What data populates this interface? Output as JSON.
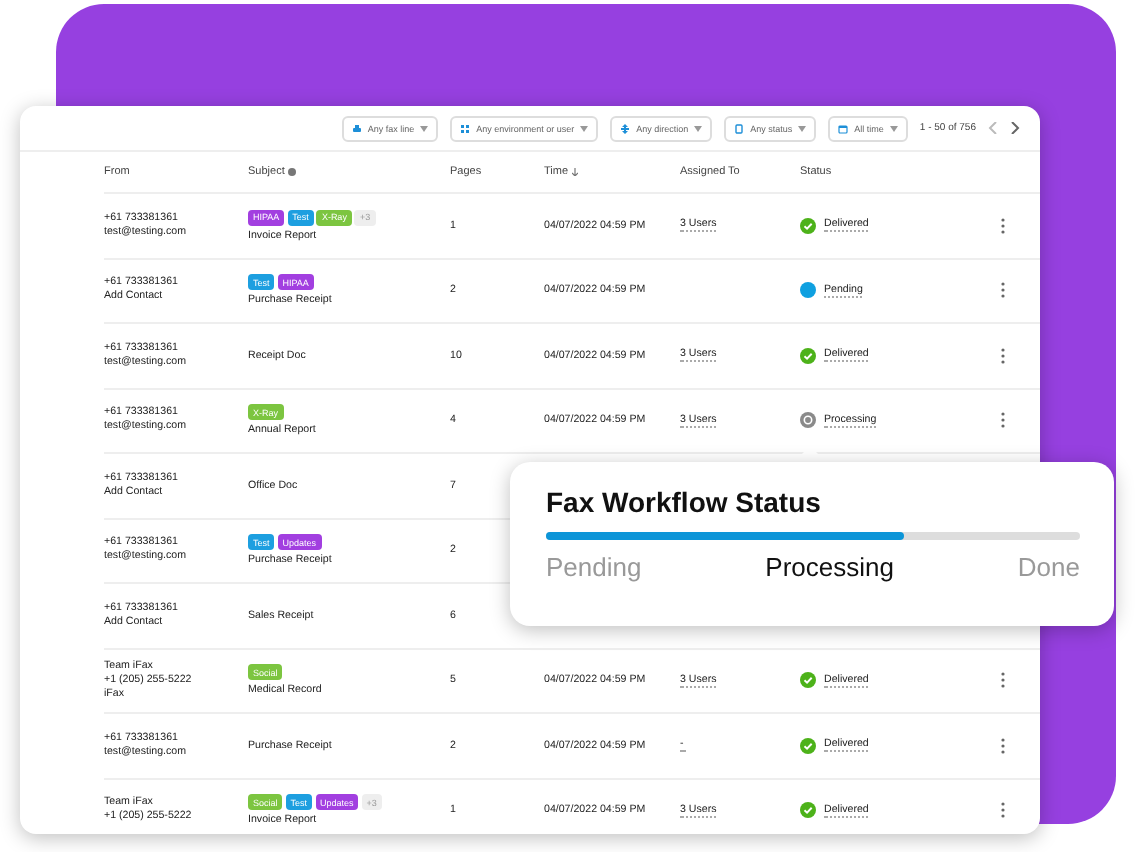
{
  "filters": [
    {
      "kind": "line",
      "label": "Any fax line"
    },
    {
      "kind": "env",
      "label": "Any environment or user"
    },
    {
      "kind": "direction",
      "label": "Any direction"
    },
    {
      "kind": "status",
      "label": "Any status"
    },
    {
      "kind": "time",
      "label": "All time"
    }
  ],
  "pagination": {
    "range": "1 - 50 of 756"
  },
  "table": {
    "columns": [
      "From",
      "Subject",
      "Pages",
      "Time",
      "Assigned To",
      "Status"
    ],
    "rows": [
      {
        "from": [
          "+61 733381361",
          "test@testing.com"
        ],
        "tags": [
          {
            "label": "HIPAA",
            "color": "#a23fe0"
          },
          {
            "label": "Test",
            "color": "#1d9fe0"
          },
          {
            "label": "X-Ray",
            "color": "#7cc540"
          },
          {
            "label": "+3",
            "color": "#eeeeee"
          }
        ],
        "subject": "Invoice Report",
        "pages": "1",
        "time": "04/07/2022 04:59 PM",
        "assigned": "3 Users",
        "status": {
          "kind": "delivered",
          "label": "Delivered"
        }
      },
      {
        "from": [
          "+61 733381361",
          "Add Contact"
        ],
        "tags": [
          {
            "label": "Test",
            "color": "#1d9fe0"
          },
          {
            "label": "HIPAA",
            "color": "#a23fe0"
          }
        ],
        "subject": "Purchase Receipt",
        "pages": "2",
        "time": "04/07/2022 04:59 PM",
        "status": {
          "kind": "pending",
          "label": "Pending"
        }
      },
      {
        "from": [
          "+61 733381361",
          "test@testing.com"
        ],
        "subject": "Receipt Doc",
        "pages": "10",
        "time": "04/07/2022 04:59 PM",
        "assigned": "3 Users",
        "status": {
          "kind": "delivered",
          "label": "Delivered"
        }
      },
      {
        "from": [
          "+61 733381361",
          "test@testing.com"
        ],
        "tags": [
          {
            "label": "X-Ray",
            "color": "#7cc540"
          }
        ],
        "subject": "Annual Report",
        "pages": "4",
        "time": "04/07/2022 04:59 PM",
        "assigned": "3 Users",
        "status": {
          "kind": "processing",
          "label": "Processing"
        }
      },
      {
        "from": [
          "+61 733381361",
          "Add Contact"
        ],
        "subject": "Office Doc",
        "pages": "7"
      },
      {
        "from": [
          "+61 733381361",
          "test@testing.com"
        ],
        "tags": [
          {
            "label": "Test",
            "color": "#1d9fe0"
          },
          {
            "label": "Updates",
            "color": "#a23fe0"
          }
        ],
        "subject": "Purchase Receipt",
        "pages": "2"
      },
      {
        "from": [
          "+61 733381361",
          "Add Contact"
        ],
        "subject": "Sales Receipt",
        "pages": "6"
      },
      {
        "from": [
          "Team iFax",
          "+1 (205) 255-5222",
          "iFax"
        ],
        "tags": [
          {
            "label": "Social",
            "color": "#7cc540"
          }
        ],
        "subject": "Medical Record",
        "pages": "5",
        "time": "04/07/2022 04:59 PM",
        "assigned": "3 Users",
        "status": {
          "kind": "delivered",
          "label": "Delivered"
        }
      },
      {
        "from": [
          "+61 733381361",
          "test@testing.com"
        ],
        "subject": "Purchase Receipt",
        "pages": "2",
        "time": "04/07/2022 04:59 PM",
        "assigned": "-",
        "status": {
          "kind": "delivered",
          "label": "Delivered"
        }
      },
      {
        "from": [
          "Team iFax",
          "+1 (205) 255-5222"
        ],
        "tags": [
          {
            "label": "Social",
            "color": "#7cc540"
          },
          {
            "label": "Test",
            "color": "#1d9fe0"
          },
          {
            "label": "Updates",
            "color": "#a23fe0"
          },
          {
            "label": "+3",
            "color": "#eeeeee"
          }
        ],
        "subject": "Invoice Report",
        "pages": "1",
        "time": "04/07/2022 04:59 PM",
        "assigned": "3 Users",
        "status": {
          "kind": "delivered",
          "label": "Delivered"
        }
      }
    ]
  },
  "workflow": {
    "title": "Fax Workflow Status",
    "level": 0.67,
    "stages": [
      {
        "label": "Pending",
        "selected": false
      },
      {
        "label": "Processing",
        "selected": true
      },
      {
        "label": "Done",
        "selected": false
      }
    ]
  }
}
